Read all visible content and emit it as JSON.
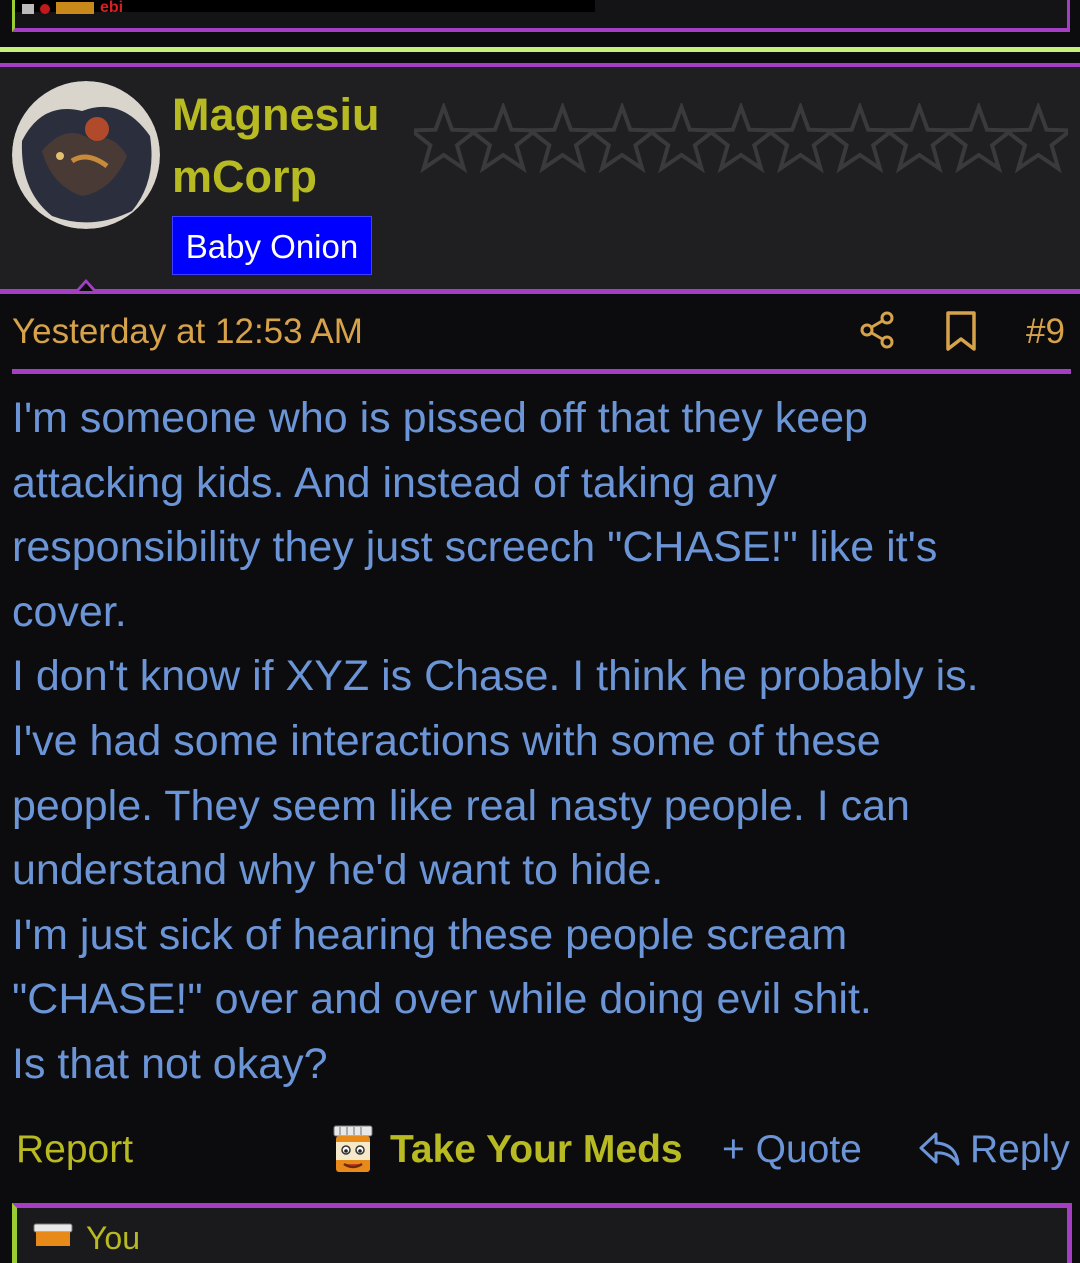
{
  "previous_post": {
    "fragment_text": "ebi"
  },
  "user": {
    "name": "MagnesiumCorp",
    "name_line1": "Magnesiu",
    "name_line2": "mCorp",
    "badge": "Baby Onion",
    "star_count": 11,
    "rating_filled": 0
  },
  "post": {
    "timestamp": "Yesterday at 12:53 AM",
    "number": "#9",
    "body": [
      "I'm someone who is pissed off that they keep",
      "attacking kids. And instead of taking any",
      "responsibility they just screech \"CHASE!\" like it's",
      "cover.",
      "I don't know if XYZ is Chase. I think he probably is.",
      "I've had some interactions with some of these",
      "people. They seem like real nasty people. I can",
      "understand why he'd want to hide.",
      "I'm just sick of hearing these people scream",
      "\"CHASE!\" over and over while doing evil shit.",
      "Is that not okay?"
    ]
  },
  "actions": {
    "report": "Report",
    "reaction": "Take Your Meds",
    "quote": "+ Quote",
    "reply": "Reply"
  },
  "next_post": {
    "author_fragment": "You"
  },
  "icons": {
    "share": "share-icon",
    "bookmark": "bookmark-icon",
    "reaction": "pill-bottle-face-icon",
    "reply": "reply-arrow-icon"
  },
  "colors": {
    "background": "#0c0c0e",
    "header_bg": "#1f1f21",
    "accent_purple": "#a43fc4",
    "accent_green": "#c7f07a",
    "username": "#b8ba22",
    "badge_bg": "#0000ff",
    "meta": "#d6a24a",
    "body_text": "#6b95d6"
  }
}
